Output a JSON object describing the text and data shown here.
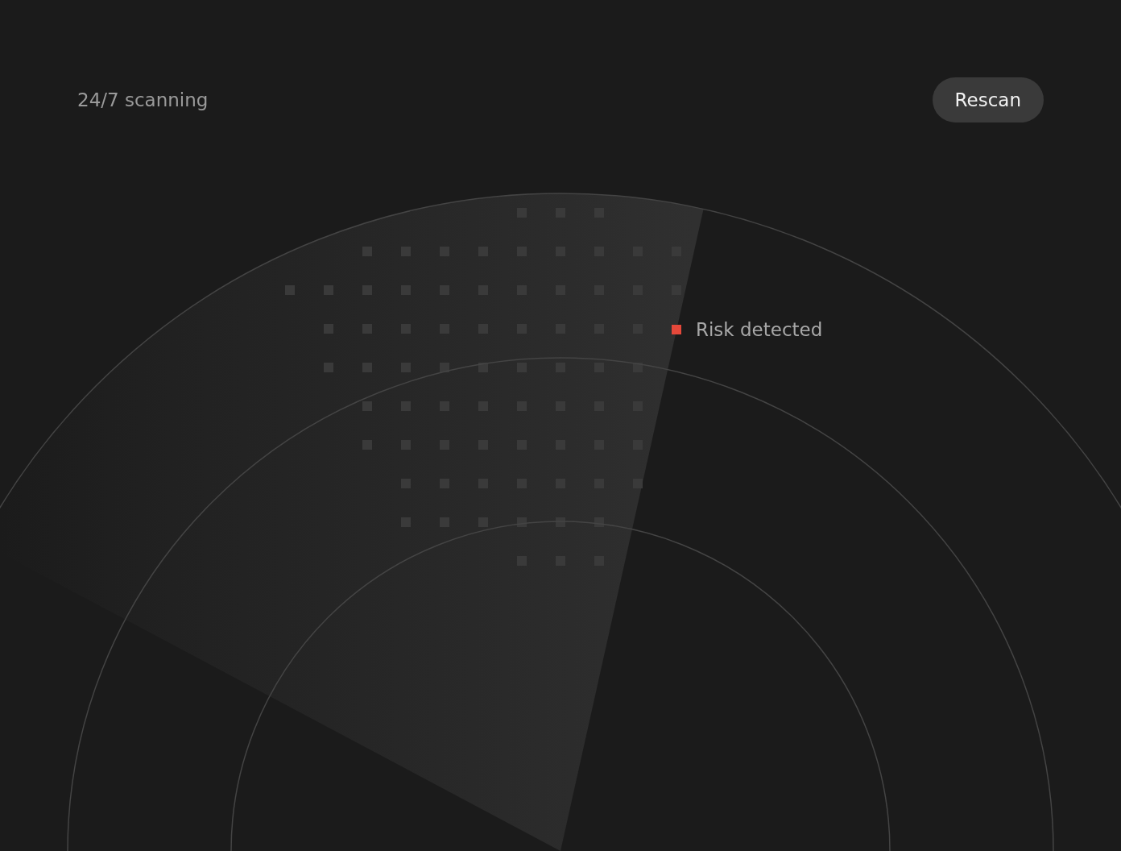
{
  "header": {
    "status": "24/7 scanning",
    "button": "Rescan"
  },
  "radar": {
    "markers": [
      {
        "label": "Risk detected",
        "color": "#e5483a"
      }
    ]
  }
}
